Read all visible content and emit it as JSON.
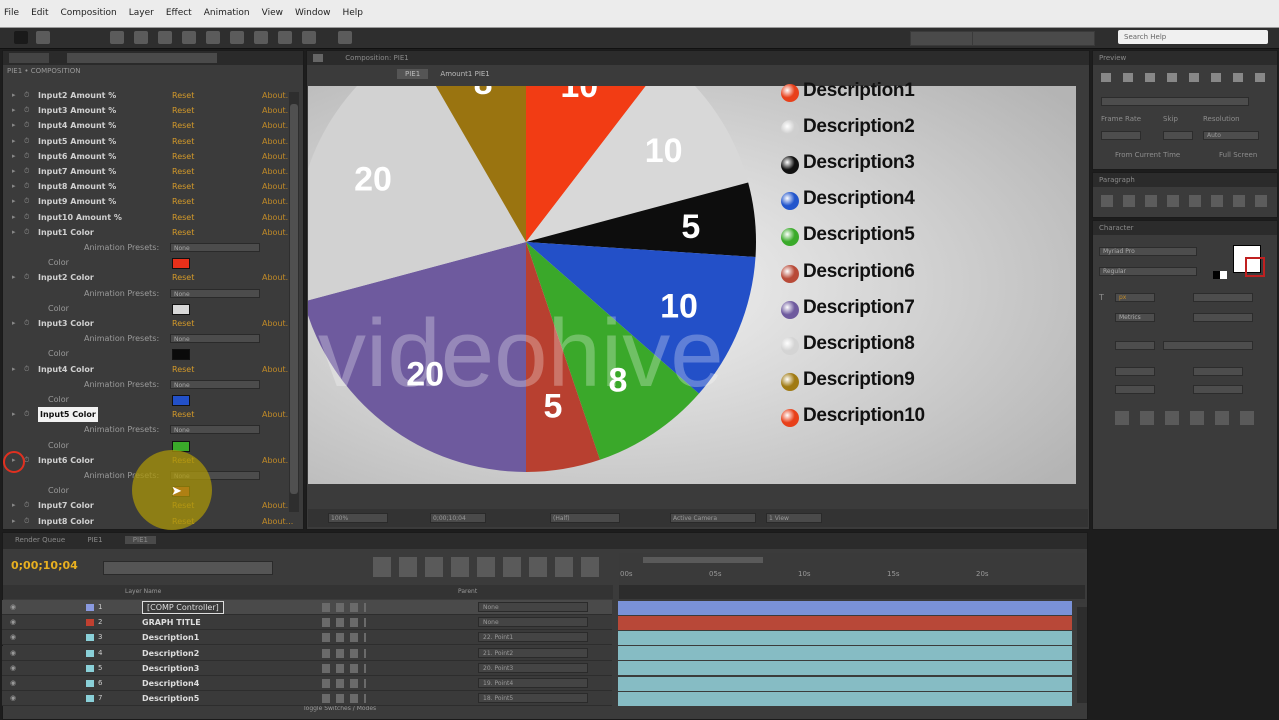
{
  "menu": [
    "File",
    "Edit",
    "Composition",
    "Layer",
    "Effect",
    "Animation",
    "View",
    "Window",
    "Help"
  ],
  "toolbar": {
    "search_placeholder": "Search Help"
  },
  "effects_panel": {
    "title": "PIE1 • COMPOSITION",
    "amount_rows": [
      "Input2 Amount %",
      "Input3 Amount %",
      "Input4 Amount %",
      "Input5 Amount %",
      "Input6 Amount %",
      "Input7 Amount %",
      "Input8 Amount %",
      "Input9 Amount %",
      "Input10 Amount %"
    ],
    "reset": "Reset",
    "about": "About...",
    "color_rows": [
      "Input1 Color",
      "Input2 Color",
      "Input3 Color",
      "Input4 Color",
      "Input5 Color",
      "Input6 Color",
      "Input7 Color",
      "Input8 Color"
    ],
    "anim_presets": "Animation Presets:",
    "preset_none": "None",
    "color_sub": "Color"
  },
  "comp_panel": {
    "tab": "Composition: PIE1",
    "breadcrumb": "PIE1",
    "breadcrumb2": "Amount1 PIE1"
  },
  "pie": {
    "slices": [
      {
        "value": 10,
        "label": "10",
        "color": "#f23c14"
      },
      {
        "value": 10,
        "label": "10",
        "color": "#d8d8d8"
      },
      {
        "value": 5,
        "label": "5",
        "color": "#0d0d0d"
      },
      {
        "value": 10,
        "label": "10",
        "color": "#2350c8"
      },
      {
        "value": 8,
        "label": "8",
        "color": "#3aa82a"
      },
      {
        "value": 5,
        "label": "5",
        "color": "#b84030"
      },
      {
        "value": 20,
        "label": "20",
        "color": "#6e5a9e"
      },
      {
        "value": 20,
        "label": "20",
        "color": "#d2d2d2"
      },
      {
        "value": 8,
        "label": "8",
        "color": "#9a7410"
      }
    ],
    "watermark": "videohive"
  },
  "legend": [
    {
      "label": "Description1",
      "color": "#e8401a"
    },
    {
      "label": "Description2",
      "color": "#cfcfcf"
    },
    {
      "label": "Description3",
      "color": "#111111"
    },
    {
      "label": "Description4",
      "color": "#2255cc"
    },
    {
      "label": "Description5",
      "color": "#3aaa2a"
    },
    {
      "label": "Description6",
      "color": "#b84a38"
    },
    {
      "label": "Description7",
      "color": "#6e5a9e"
    },
    {
      "label": "Description8",
      "color": "#d4d4d4"
    },
    {
      "label": "Description9",
      "color": "#a07a12"
    },
    {
      "label": "Description10",
      "color": "#e8401a"
    }
  ],
  "viewer_bar": {
    "zoom": "100%",
    "time": "0;00;10;04",
    "quality": "(Half)",
    "camera": "Active Camera",
    "views": "1 View"
  },
  "right_panels": {
    "preview": "Preview",
    "paragraph": "Paragraph",
    "character": "Character",
    "frame_rate": "Frame Rate",
    "skip": "Skip",
    "resolution": "Resolution",
    "auto": "Auto",
    "full_screen": "Full Screen",
    "from_current": "From Current Time",
    "font": "Myriad Pro",
    "font_style": "Regular",
    "px": "px",
    "metrics": "Metrics"
  },
  "timeline": {
    "tabs": [
      "Render Queue",
      "PIE1",
      "PIE1"
    ],
    "timecode": "0;00;10;04",
    "col_header": "Layer Name",
    "parent_header": "Parent",
    "rows": [
      {
        "num": "1",
        "name": "[COMP Controller]",
        "label_color": "#8a9ae0",
        "parent": "None",
        "bar": "#7a92d8"
      },
      {
        "num": "2",
        "name": "GRAPH TITLE",
        "label_color": "#c04030",
        "parent": "None",
        "bar": "#b84838"
      },
      {
        "num": "3",
        "name": "Description1",
        "label_color": "#8ad0d8",
        "parent": "22. Point1",
        "bar": "#86bcc4"
      },
      {
        "num": "4",
        "name": "Description2",
        "label_color": "#8ad0d8",
        "parent": "21. Point2",
        "bar": "#86bcc4"
      },
      {
        "num": "5",
        "name": "Description3",
        "label_color": "#8ad0d8",
        "parent": "20. Point3",
        "bar": "#86bcc4"
      },
      {
        "num": "6",
        "name": "Description4",
        "label_color": "#8ad0d8",
        "parent": "19. Point4",
        "bar": "#86bcc4"
      },
      {
        "num": "7",
        "name": "Description5",
        "label_color": "#8ad0d8",
        "parent": "18. Point5",
        "bar": "#86bcc4"
      }
    ],
    "ruler": [
      "00s",
      "05s",
      "10s",
      "15s",
      "20s"
    ],
    "toggle": "Toggle Switches / Modes"
  }
}
